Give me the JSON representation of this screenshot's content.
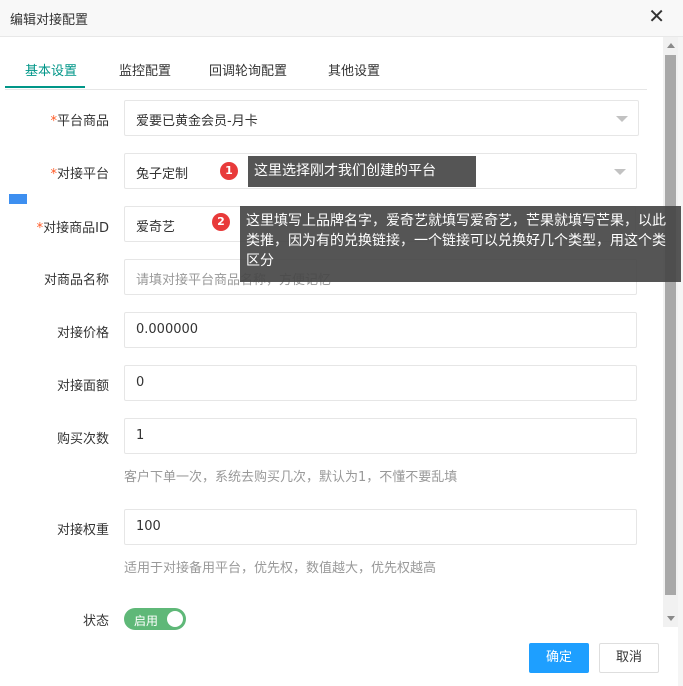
{
  "dialog": {
    "title": "编辑对接配置"
  },
  "tabs": [
    {
      "label": "基本设置"
    },
    {
      "label": "监控配置"
    },
    {
      "label": "回调轮询配置"
    },
    {
      "label": "其他设置"
    }
  ],
  "form": {
    "platform_product": {
      "label": "平台商品",
      "required": "*",
      "value": "爱要已黄金会员-月卡"
    },
    "dock_platform": {
      "label": "对接平台",
      "required": "*",
      "value": "兔子定制"
    },
    "dock_product_id": {
      "label": "对接商品ID",
      "required": "*",
      "value": "爱奇艺"
    },
    "dock_product_name": {
      "label": "对商品名称",
      "placeholder": "请填对接平台商品名称，方便记忆"
    },
    "dock_price": {
      "label": "对接价格",
      "value": "0.000000"
    },
    "dock_face_value": {
      "label": "对接面额",
      "value": "0"
    },
    "buy_count": {
      "label": "购买次数",
      "value": "1",
      "hint": "客户下单一次，系统去购买几次，默认为1，不懂不要乱填"
    },
    "dock_weight": {
      "label": "对接权重",
      "value": "100",
      "hint": "适用于对接备用平台，优先权，数值越大，优先权越高"
    },
    "status": {
      "label": "状态",
      "toggle_label": "启用"
    }
  },
  "buttons": {
    "confirm": "确定",
    "cancel": "取消"
  },
  "annotations": [
    {
      "number": "1",
      "text": "这里选择刚才我们创建的平台"
    },
    {
      "number": "2",
      "text": "这里填写上品牌名字，爱奇艺就填写爱奇艺，芒果就填写芒果，以此类推，因为有的兑换链接，一个链接可以兑换好几个类型，用这个类区分"
    }
  ],
  "colors": {
    "accent": "#009688",
    "primary_button": "#1E9FFF",
    "toggle_on": "#5FB878",
    "required": "#ff5722",
    "badge": "#e83a3a"
  }
}
